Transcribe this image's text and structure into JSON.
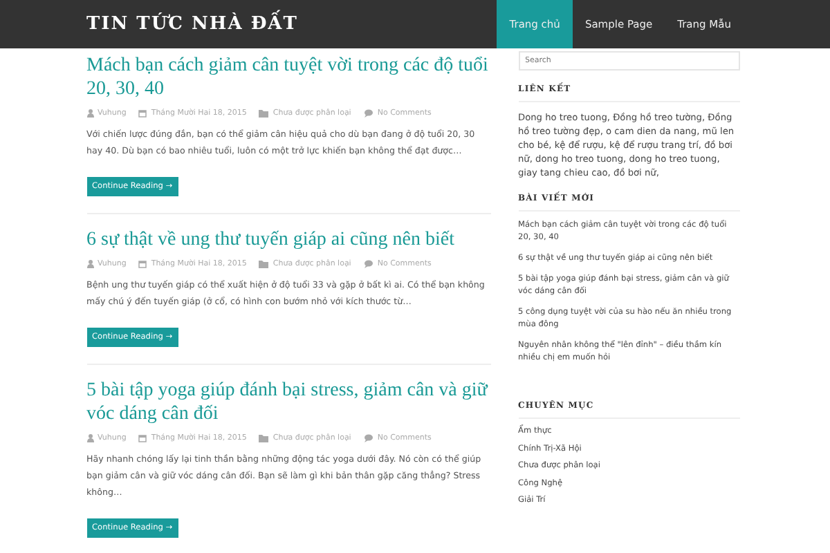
{
  "site": {
    "title": "TIN TỨC NHÀ ĐẤT"
  },
  "nav": [
    {
      "label": "Trang chủ",
      "selected": true
    },
    {
      "label": "Sample Page",
      "selected": false
    },
    {
      "label": "Trang Mẫu",
      "selected": false
    }
  ],
  "posts": [
    {
      "title": "Mách bạn cách giảm cân tuyệt vời trong các độ tuổi 20, 30, 40",
      "author": "Vuhung",
      "date": "Tháng Mười Hai 18, 2015",
      "category": "Chưa được phân loại",
      "comments": "No Comments",
      "excerpt": "Với chiến lược đúng đắn, bạn có thể giảm cân hiệu quả cho dù bạn đang ở độ tuổi 20, 30 hay 40. Dù bạn có bao nhiêu tuổi, luôn có một trở lực khiến bạn không thể đạt được…",
      "button": "Continue Reading →"
    },
    {
      "title": "6 sự thật về ung thư tuyến giáp ai cũng nên biết",
      "author": "Vuhung",
      "date": "Tháng Mười Hai 18, 2015",
      "category": "Chưa được phân loại",
      "comments": "No Comments",
      "excerpt": "Bệnh ung thư tuyến giáp có thể xuất hiện ở độ tuổi 33 và gặp ở bất kì ai. Có thể bạn không mấy chú ý đến tuyến giáp (ở cổ, có hình con bướm nhỏ với kích thước từ…",
      "button": "Continue Reading →"
    },
    {
      "title": "5 bài tập yoga giúp đánh bại stress, giảm cân và giữ vóc dáng cân đối",
      "author": "Vuhung",
      "date": "Tháng Mười Hai 18, 2015",
      "category": "Chưa được phân loại",
      "comments": "No Comments",
      "excerpt": "Hãy nhanh chóng lấy lại tinh thần bằng những động tác yoga dưới đây. Nó còn có thể giúp bạn giảm cân và giữ vóc dáng cân đối. Bạn sẽ làm gì khi bản thân gặp căng thẳng? Stress không…",
      "button": "Continue Reading →"
    }
  ],
  "sidebar": {
    "search": {
      "placeholder": "Search"
    },
    "links": {
      "heading": "LIÊN KẾT",
      "text": "Dong ho treo tuong, Đồng hồ treo tường, Đồng hồ treo tường đẹp, o cam dien da nang, mũ len cho bé, kệ để rượu, kệ để rượu trang trí, đồ bơi nữ, dong ho treo tuong, dong ho treo tuong, giay tang chieu cao, đồ bơi nữ,"
    },
    "recent": {
      "heading": "BÀI VIẾT MỚI",
      "items": [
        "Mách bạn cách giảm cân tuyệt vời trong các độ tuổi 20, 30, 40",
        "6 sự thật về ung thư tuyến giáp ai cũng nên biết",
        "5 bài tập yoga giúp đánh bại stress, giảm cân và giữ vóc dáng cân đối",
        "5 công dụng tuyệt vời của su hào nếu ăn nhiều trong mùa đông",
        "Nguyên nhân không thể \"lên đỉnh\" – điều thầm kín nhiều chị em muốn hỏi"
      ]
    },
    "categories": {
      "heading": "CHUYÊN MỤC",
      "items": [
        "Ẩm thực",
        "Chính Trị-Xã Hội",
        "Chưa được phân loại",
        "Công Nghệ",
        "Giải Trí"
      ]
    }
  }
}
